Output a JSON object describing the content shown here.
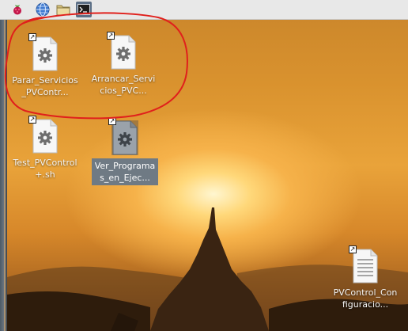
{
  "taskbar": {
    "launchers": [
      {
        "name": "raspberry-menu-icon"
      },
      {
        "name": "web-browser-icon"
      },
      {
        "name": "file-manager-icon"
      },
      {
        "name": "terminal-icon",
        "glyph": ">_"
      }
    ]
  },
  "desktop": {
    "icons": [
      {
        "name": "desktop-icon-parar-servicios",
        "label": "Parar_Servicios_PVContr...",
        "type": "script"
      },
      {
        "name": "desktop-icon-arrancar-servicios",
        "label": "Arrancar_Servicios_PVC...",
        "type": "script"
      },
      {
        "name": "desktop-icon-test-pvcontrol",
        "label": "Test_PVControl+.sh",
        "type": "script"
      },
      {
        "name": "desktop-icon-ver-programas",
        "label": "Ver_Programas_en_Ejec...",
        "type": "script",
        "selected": true
      },
      {
        "name": "desktop-icon-pvcontrol-config",
        "label": "PVControl_Configuracio...",
        "type": "text"
      }
    ]
  },
  "colors": {
    "annotation": "#e0201c",
    "selection": "#6f7a84"
  }
}
